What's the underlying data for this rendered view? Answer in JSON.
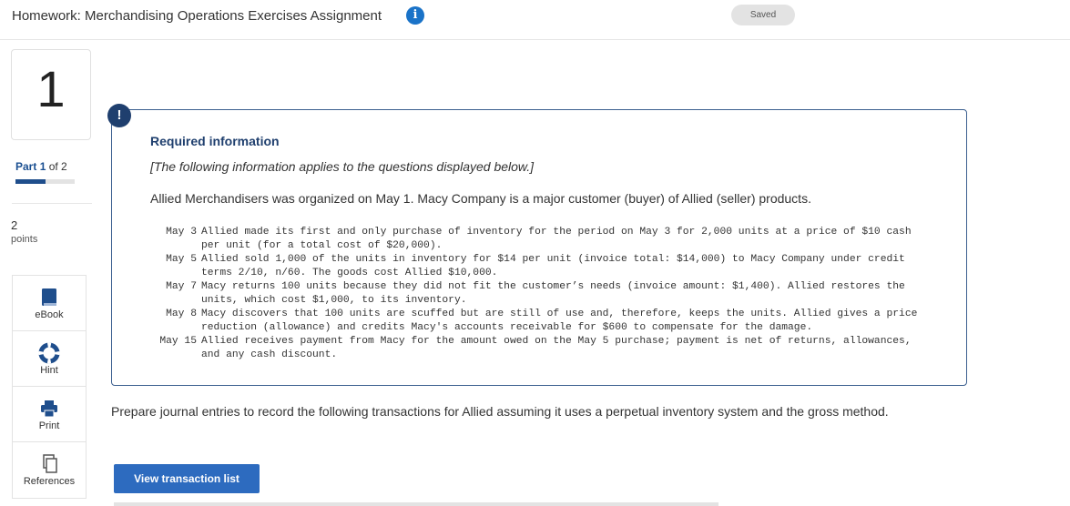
{
  "header": {
    "title": "Homework: Merchandising Operations Exercises Assignment",
    "info_icon": "info-icon",
    "saved_label": "Saved"
  },
  "sidebar": {
    "question_number": "1",
    "part_label": "Part",
    "part_current": "1",
    "part_of": "of 2",
    "part_progress": 0.5,
    "points_value": "2",
    "points_label": "points",
    "tools": [
      {
        "label": "eBook",
        "icon": "book-icon"
      },
      {
        "label": "Hint",
        "icon": "lifebuoy-icon"
      },
      {
        "label": "Print",
        "icon": "printer-icon"
      },
      {
        "label": "References",
        "icon": "copy-icon"
      }
    ]
  },
  "required": {
    "alert_icon": "!",
    "title": "Required information",
    "note": "[The following information applies to the questions displayed below.]",
    "intro": "Allied Merchandisers was organized on May 1. Macy Company is a major customer (buyer) of Allied (seller) products.",
    "transactions": [
      {
        "date": "May 3",
        "text": "Allied made its first and only purchase of inventory for the period on May 3 for 2,000 units at a price of $10 cash per unit (for a total cost of $20,000)."
      },
      {
        "date": "May 5",
        "text": "Allied sold 1,000 of the units in inventory for $14 per unit (invoice total: $14,000) to Macy Company under credit terms 2/10, n/60. The goods cost Allied $10,000."
      },
      {
        "date": "May 7",
        "text": "Macy returns 100 units because they did not fit the customer’s needs (invoice amount: $1,400). Allied restores the units, which cost $1,000, to its inventory."
      },
      {
        "date": "May 8",
        "text": "Macy discovers that 100 units are scuffed but are still of use and, therefore, keeps the units. Allied gives a price reduction (allowance) and credits Macy's accounts receivable for $600 to compensate for the damage."
      },
      {
        "date": "May 15",
        "text": "Allied receives payment from Macy for the amount owed on the May 5 purchase; payment is net of returns, allowances, and any cash discount."
      }
    ]
  },
  "prompt": "Prepare journal entries to record the following transactions for Allied assuming it uses a perpetual inventory system and the gross method.",
  "view_button": "View transaction list",
  "colors": {
    "accent": "#2d6bbf",
    "navy": "#1f3f6e",
    "info": "#1a73c8"
  }
}
